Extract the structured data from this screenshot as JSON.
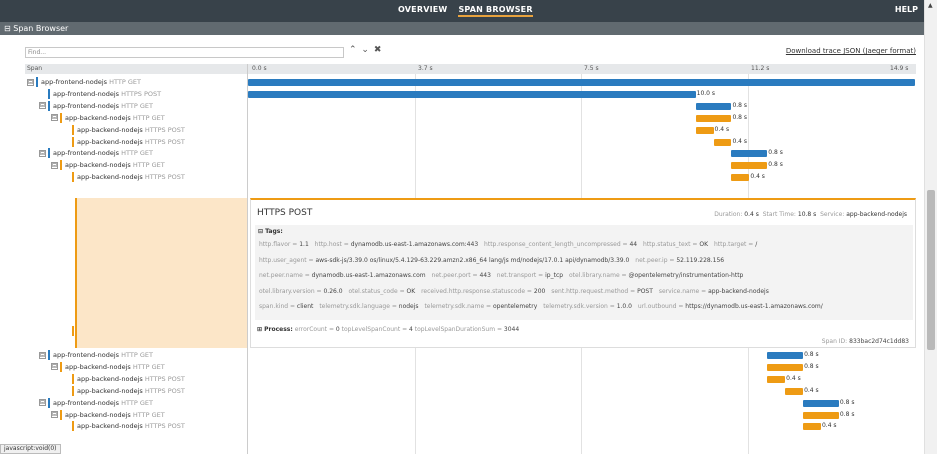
{
  "topbar": {
    "overview": "OVERVIEW",
    "span_browser": "SPAN BROWSER",
    "help": "HELP"
  },
  "subbar": {
    "title": "⊟ Span Browser"
  },
  "find": {
    "placeholder": "Find...",
    "prev": "⌃",
    "next": "⌄",
    "clear": "✖"
  },
  "download_label": "Download trace JSON (Jaeger format)",
  "header": {
    "span": "Span",
    "ticks": [
      "0.0 s",
      "3.7 s",
      "7.5 s",
      "11.2 s",
      "14.9 s"
    ]
  },
  "rows": [
    {
      "svc": "app-frontend-nodejs",
      "op": "HTTP GET",
      "kind": "front",
      "toggle": "⊟",
      "bar_start": 0.0,
      "dur": 14.9,
      "dur_label": ""
    },
    {
      "svc": "app-frontend-nodejs",
      "op": "HTTPS POST",
      "kind": "front",
      "toggle": "",
      "bar_start": 0.0,
      "dur": 10.0,
      "dur_label": "10.0 s"
    },
    {
      "svc": "app-frontend-nodejs",
      "op": "HTTP GET",
      "kind": "front",
      "toggle": "⊟",
      "bar_start": 10.0,
      "dur": 0.8,
      "dur_label": "0.8 s"
    },
    {
      "svc": "app-backend-nodejs",
      "op": "HTTP GET",
      "kind": "back",
      "toggle": "⊟",
      "bar_start": 10.0,
      "dur": 0.8,
      "dur_label": "0.8 s"
    },
    {
      "svc": "app-backend-nodejs",
      "op": "HTTPS POST",
      "kind": "back",
      "toggle": "",
      "bar_start": 10.0,
      "dur": 0.4,
      "dur_label": "0.4 s"
    },
    {
      "svc": "app-backend-nodejs",
      "op": "HTTPS POST",
      "kind": "back",
      "toggle": "",
      "bar_start": 10.4,
      "dur": 0.4,
      "dur_label": "0.4 s"
    },
    {
      "svc": "app-frontend-nodejs",
      "op": "HTTP GET",
      "kind": "front",
      "toggle": "⊟",
      "bar_start": 10.8,
      "dur": 0.8,
      "dur_label": "0.8 s"
    },
    {
      "svc": "app-backend-nodejs",
      "op": "HTTP GET",
      "kind": "back",
      "toggle": "⊟",
      "bar_start": 10.8,
      "dur": 0.8,
      "dur_label": "0.8 s"
    },
    {
      "svc": "app-backend-nodejs",
      "op": "HTTPS POST",
      "kind": "back",
      "toggle": "",
      "bar_start": 10.8,
      "dur": 0.4,
      "dur_label": "0.4 s"
    },
    {
      "svc": "app-backend-nodejs",
      "op": "HTTPS POST",
      "kind": "back",
      "toggle": "",
      "bar_start": 11.2,
      "dur": 0.4,
      "dur_label": "0.4 s"
    },
    {
      "svc": "app-frontend-nodejs",
      "op": "HTTP GET",
      "kind": "front",
      "toggle": "⊟",
      "bar_start": 11.6,
      "dur": 0.8,
      "dur_label": "0.8 s"
    },
    {
      "svc": "app-backend-nodejs",
      "op": "HTTP GET",
      "kind": "back",
      "toggle": "⊟",
      "bar_start": 11.6,
      "dur": 0.8,
      "dur_label": "0.8 s"
    },
    {
      "svc": "app-backend-nodejs",
      "op": "HTTPS POST",
      "kind": "back",
      "toggle": "",
      "bar_start": 11.6,
      "dur": 0.4,
      "dur_label": "0.4 s"
    },
    {
      "svc": "app-backend-nodejs",
      "op": "HTTPS POST",
      "kind": "back",
      "toggle": "",
      "bar_start": 12.0,
      "dur": 0.4,
      "dur_label": "0.4 s"
    },
    {
      "svc": "app-frontend-nodejs",
      "op": "HTTP GET",
      "kind": "front",
      "toggle": "⊟",
      "bar_start": 12.4,
      "dur": 0.8,
      "dur_label": "0.8 s"
    },
    {
      "svc": "app-backend-nodejs",
      "op": "HTTP GET",
      "kind": "back",
      "toggle": "⊟",
      "bar_start": 12.4,
      "dur": 0.8,
      "dur_label": "0.8 s"
    },
    {
      "svc": "app-backend-nodejs",
      "op": "HTTPS POST",
      "kind": "back",
      "toggle": "",
      "bar_start": 12.4,
      "dur": 0.4,
      "dur_label": "0.4 s"
    }
  ],
  "detail": {
    "title": "HTTPS POST",
    "duration_label": "Duration:",
    "duration": "0.4 s",
    "start_label": "Start Time:",
    "start": "10.8 s",
    "service_label": "Service:",
    "service": "app-backend-nodejs",
    "tags_label": "⊟ Tags:",
    "tag_lines": [
      [
        [
          "http.flavor",
          "1.1"
        ],
        [
          "http.host",
          "dynamodb.us-east-1.amazonaws.com:443"
        ],
        [
          "http.response_content_length_uncompressed",
          "44"
        ],
        [
          "http.status_text",
          "OK"
        ],
        [
          "http.target",
          "/"
        ]
      ],
      [
        [
          "http.user_agent",
          "aws-sdk-js/3.39.0 os/linux/5.4.129-63.229.amzn2.x86_64 lang/js md/nodejs/17.0.1 api/dynamodb/3.39.0"
        ],
        [
          "net.peer.ip",
          "52.119.228.156"
        ]
      ],
      [
        [
          "net.peer.name",
          "dynamodb.us-east-1.amazonaws.com"
        ],
        [
          "net.peer.port",
          "443"
        ],
        [
          "net.transport",
          "ip_tcp"
        ],
        [
          "otel.library.name",
          "@opentelemetry/instrumentation-http"
        ]
      ],
      [
        [
          "otel.library.version",
          "0.26.0"
        ],
        [
          "otel.status_code",
          "OK"
        ],
        [
          "received.http.response.statuscode",
          "200"
        ],
        [
          "sent.http.request.method",
          "POST"
        ],
        [
          "service.name",
          "app-backend-nodejs"
        ]
      ],
      [
        [
          "span.kind",
          "client"
        ],
        [
          "telemetry.sdk.language",
          "nodejs"
        ],
        [
          "telemetry.sdk.name",
          "opentelemetry"
        ],
        [
          "telemetry.sdk.version",
          "1.0.0"
        ],
        [
          "url.outbound",
          "https://dynamodb.us-east-1.amazonaws.com/"
        ]
      ]
    ],
    "process_label": "⊞ Process:",
    "process": [
      [
        "errorCount",
        "0"
      ],
      [
        "topLevelSpanCount",
        "4"
      ],
      [
        "topLevelSpanDurationSum",
        "3044"
      ]
    ],
    "span_id_label": "Span ID:",
    "span_id": "833bac2d74c1dd83"
  },
  "status_text": "javascript:void(0)",
  "colors": {
    "frontend": "#2a7bbf",
    "backend": "#ee9b14",
    "topbar": "#38424a"
  }
}
